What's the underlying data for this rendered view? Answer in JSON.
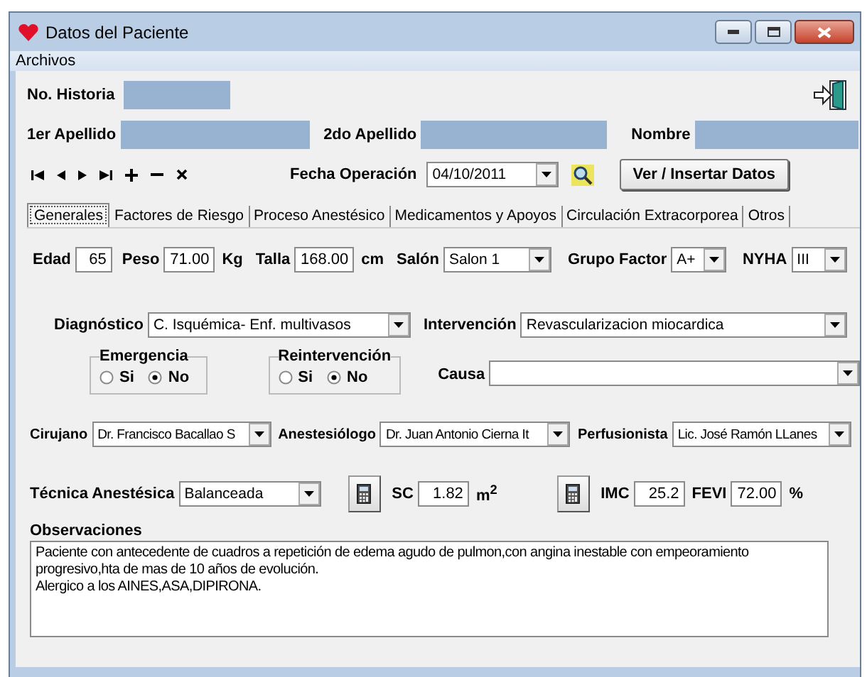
{
  "window": {
    "title": "Datos del Paciente"
  },
  "menu": [
    "Archivos"
  ],
  "historia": {
    "label": "No. Historia"
  },
  "names": [
    {
      "label": "1er Apellido"
    },
    {
      "label": "2do Apellido"
    },
    {
      "label": "Nombre"
    }
  ],
  "fecha": {
    "label": "Fecha Operación",
    "value": "04/10/2011"
  },
  "ver_button": "Ver / Insertar Datos",
  "tabs": [
    {
      "label": "Generales",
      "selected": true
    },
    {
      "label": "Factores de Riesgo",
      "selected": false
    },
    {
      "label": "Proceso Anestésico",
      "selected": false
    },
    {
      "label": "Medicamentos y Apoyos",
      "selected": false
    },
    {
      "label": "Circulación Extracorporea",
      "selected": false
    },
    {
      "label": "Otros",
      "selected": false
    }
  ],
  "row1": [
    {
      "kind": "input",
      "label": "Edad",
      "value": "65"
    },
    {
      "kind": "input",
      "label": "Peso",
      "value": "71.00",
      "unit": "Kg"
    },
    {
      "kind": "input",
      "label": "Talla",
      "value": "168.00",
      "unit": "cm"
    },
    {
      "kind": "combo",
      "label": "Salón",
      "value": "Salon 1"
    },
    {
      "kind": "combo",
      "label": "Grupo Factor",
      "value": "A+"
    },
    {
      "kind": "combo",
      "label": "NYHA",
      "value": "III"
    }
  ],
  "row2": [
    {
      "kind": "combo",
      "label": "Diagnóstico",
      "value": "C. Isquémica- Enf. multivasos"
    },
    {
      "kind": "combo",
      "label": "Intervención",
      "value": "Revascularizacion miocardica"
    }
  ],
  "groups": [
    {
      "title": "Emergencia",
      "options": [
        {
          "label": "Si",
          "selected": false
        },
        {
          "label": "No",
          "selected": true
        }
      ]
    },
    {
      "title": "Reintervención",
      "options": [
        {
          "label": "Si",
          "selected": false
        },
        {
          "label": "No",
          "selected": true
        }
      ]
    }
  ],
  "causa": {
    "label": "Causa"
  },
  "row3": [
    {
      "kind": "combo",
      "label": "Cirujano",
      "value": "Dr. Francisco Bacallao  S"
    },
    {
      "kind": "combo",
      "label": "Anestesiólogo",
      "value": "Dr. Juan Antonio Cierna It"
    },
    {
      "kind": "combo",
      "label": "Perfusionista",
      "value": "Lic. José Ramón LLanes"
    }
  ],
  "row4": [
    {
      "kind": "combo",
      "label": "Técnica Anestésica",
      "value": "Balanceada"
    },
    {
      "kind": "calc"
    },
    {
      "kind": "input",
      "label": "SC",
      "value": "1.82",
      "unit": "m$^{2}$"
    },
    {
      "kind": "calc"
    },
    {
      "kind": "input",
      "label": "IMC",
      "value": "25.2"
    },
    {
      "kind": "input",
      "label": "FEVI",
      "value": "72.00",
      "unit": "%"
    }
  ],
  "observaciones": {
    "label": "Observaciones",
    "value": "Paciente con antecedente de cuadros a repetición de edema agudo de pulmon,con angina inestable con empeoramiento progresivo,hta de mas de 10 años de evolución.\nAlergico a los AINES,ASA,DIPIRONA."
  }
}
